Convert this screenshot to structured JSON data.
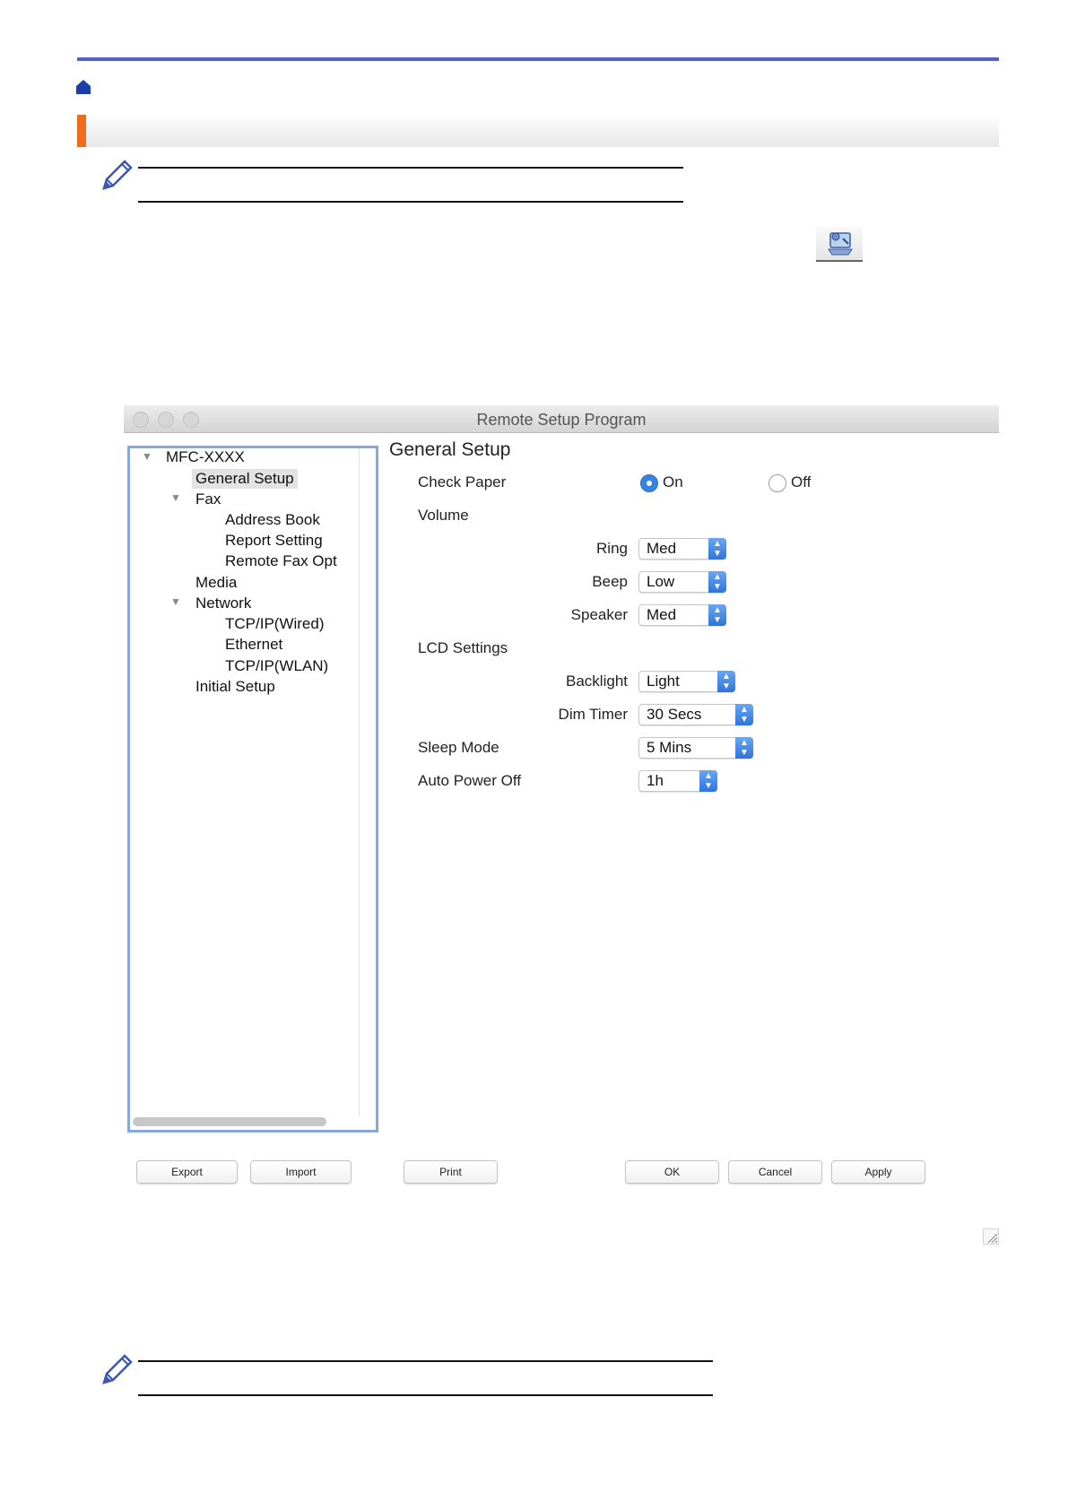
{
  "window": {
    "title": "Remote Setup Program"
  },
  "tree": {
    "root": "MFC-XXXX",
    "items": [
      {
        "label": "General Setup",
        "level": 1,
        "selected": true
      },
      {
        "label": "Fax",
        "level": 1,
        "expanded": true
      },
      {
        "label": "Address Book",
        "level": 2
      },
      {
        "label": "Report Setting",
        "level": 2
      },
      {
        "label": "Remote Fax Opt",
        "level": 2
      },
      {
        "label": "Media",
        "level": 1
      },
      {
        "label": "Network",
        "level": 1,
        "expanded": true
      },
      {
        "label": "TCP/IP(Wired)",
        "level": 2
      },
      {
        "label": "Ethernet",
        "level": 2
      },
      {
        "label": "TCP/IP(WLAN)",
        "level": 2
      },
      {
        "label": "Initial Setup",
        "level": 1
      }
    ]
  },
  "panel": {
    "heading": "General Setup",
    "check_paper": {
      "label": "Check Paper",
      "on_label": "On",
      "off_label": "Off",
      "selected": "On"
    },
    "volume": {
      "label": "Volume",
      "ring": {
        "label": "Ring",
        "value": "Med"
      },
      "beep": {
        "label": "Beep",
        "value": "Low"
      },
      "speaker": {
        "label": "Speaker",
        "value": "Med"
      }
    },
    "lcd": {
      "label": "LCD Settings",
      "backlight": {
        "label": "Backlight",
        "value": "Light"
      },
      "dim_timer": {
        "label": "Dim Timer",
        "value": "30 Secs"
      }
    },
    "sleep_mode": {
      "label": "Sleep Mode",
      "value": "5 Mins"
    },
    "auto_power_off": {
      "label": "Auto Power Off",
      "value": "1h"
    }
  },
  "buttons": {
    "export": "Export",
    "import": "Import",
    "print": "Print",
    "ok": "OK",
    "cancel": "Cancel",
    "apply": "Apply"
  },
  "colors": {
    "header_rule": "#5560c8",
    "section_accent": "#f26a1b",
    "selection_blue": "#3b82e0"
  },
  "icons": [
    "home-icon",
    "pencil-note-icon",
    "remote-setup-toolbar-icon",
    "resize-grip-icon"
  ]
}
